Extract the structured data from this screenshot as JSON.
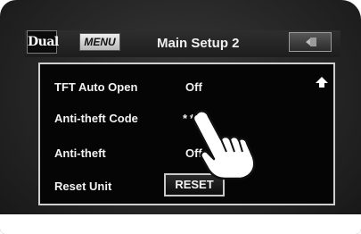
{
  "header": {
    "logo_text": "Dual",
    "menu_label": "MENU",
    "title": "Main Setup 2",
    "back_icon": "back-arrow-icon"
  },
  "settings": [
    {
      "label": "TFT Auto Open",
      "value": "Off"
    },
    {
      "label": "Anti-theft Code",
      "value": "**"
    },
    {
      "label": "Anti-theft",
      "value": "Off"
    },
    {
      "label": "Reset Unit",
      "button": "RESET"
    }
  ],
  "scroll": {
    "up_icon": "scroll-up-arrow-icon"
  },
  "overlay": {
    "pointer_icon": "pointing-hand-icon"
  },
  "colors": {
    "screen_bg": "#050505",
    "bezel": "#262626",
    "text": "#f2f2f2",
    "border": "#cfcfcf"
  }
}
